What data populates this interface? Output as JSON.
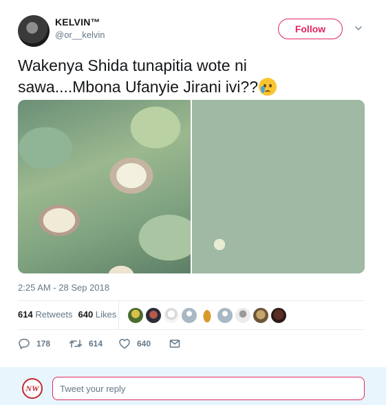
{
  "user": {
    "display_name": "KELVIN™",
    "handle": "@or__kelvin"
  },
  "follow_button": {
    "label": "Follow"
  },
  "tweet": {
    "text_line1": "Wakenya Shida tunapitia wote ni",
    "text_line2": "sawa....Mbona Ufanyie Jirani ivi??",
    "emoji": "crying-face-emoji",
    "timestamp": "2:25 AM - 28 Sep 2018"
  },
  "stats": {
    "retweets_count": "614",
    "retweets_label": "Retweets",
    "likes_count": "640",
    "likes_label": "Likes"
  },
  "actions": {
    "reply_count": "178",
    "retweet_count": "614",
    "like_count": "640"
  },
  "reply": {
    "avatar_text": "NW",
    "placeholder": "Tweet your reply"
  },
  "colors": {
    "accent": "#e0245e",
    "secondary_text": "#657786",
    "reply_bar_bg": "#e8f5fd"
  }
}
